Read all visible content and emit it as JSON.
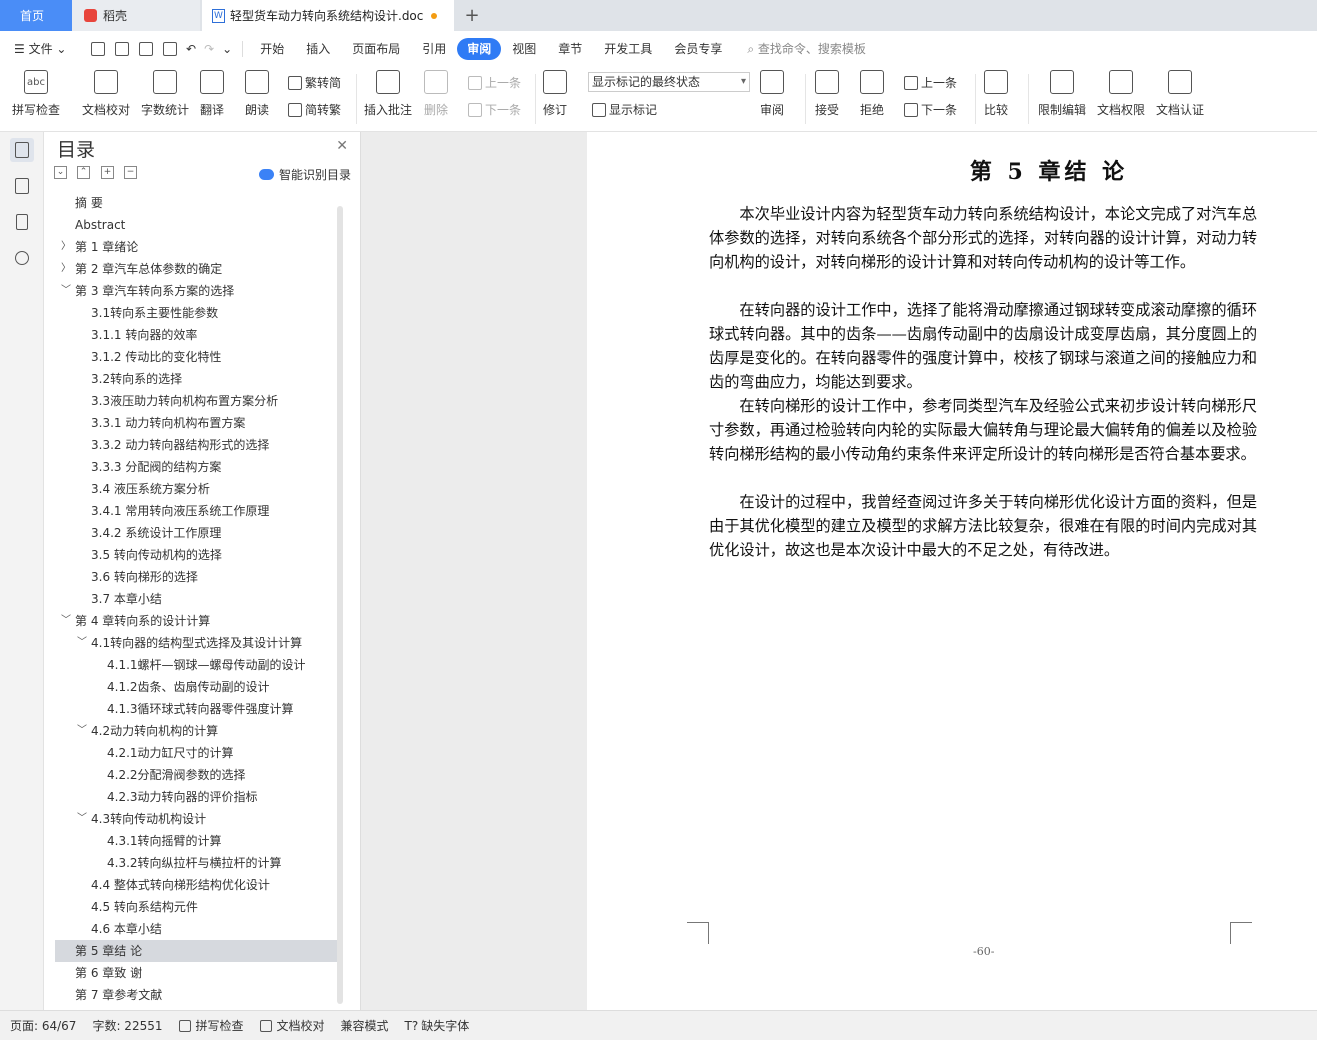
{
  "tabs": {
    "home": "首页",
    "daoke": "稻壳",
    "document": "轻型货车动力转向系统结构设计.doc"
  },
  "menu": {
    "file": "文件",
    "items": [
      "开始",
      "插入",
      "页面布局",
      "引用",
      "审阅",
      "视图",
      "章节",
      "开发工具",
      "会员专享"
    ],
    "active": "审阅",
    "search_placeholder": "查找命令、搜索模板"
  },
  "ribbon": {
    "spellcheck": "拼写检查",
    "proofread": "文档校对",
    "wordcount": "字数统计",
    "translate": "翻译",
    "read_aloud": "朗读",
    "trad_to_simp": "繁转简",
    "simp_to_trad": "简转繁",
    "insert_comment": "插入批注",
    "delete": "删除",
    "prev_comment": "上一条",
    "next_comment": "下一条",
    "track": "修订",
    "markup_state": "显示标记的最终状态",
    "show_markup": "显示标记",
    "review": "审阅",
    "accept": "接受",
    "reject": "拒绝",
    "prev_change": "上一条",
    "next_change": "下一条",
    "compare": "比较",
    "restrict": "限制编辑",
    "doc_rights": "文档权限",
    "doc_cert": "文档认证"
  },
  "toc": {
    "title": "目录",
    "smart": "智能识别目录",
    "items": [
      {
        "label": "摘 要",
        "level": 0,
        "arrow": ""
      },
      {
        "label": "Abstract",
        "level": 0,
        "arrow": ""
      },
      {
        "label": "第 1 章绪论",
        "level": 0,
        "arrow": "right"
      },
      {
        "label": "第 2 章汽车总体参数的确定",
        "level": 0,
        "arrow": "right"
      },
      {
        "label": "第 3 章汽车转向系方案的选择",
        "level": 0,
        "arrow": "down"
      },
      {
        "label": "3.1转向系主要性能参数",
        "level": 1,
        "arrow": ""
      },
      {
        "label": "3.1.1 转向器的效率",
        "level": 1,
        "arrow": ""
      },
      {
        "label": "3.1.2 传动比的变化特性",
        "level": 1,
        "arrow": ""
      },
      {
        "label": "3.2转向系的选择",
        "level": 1,
        "arrow": ""
      },
      {
        "label": "3.3液压助力转向机构布置方案分析",
        "level": 1,
        "arrow": ""
      },
      {
        "label": "3.3.1 动力转向机构布置方案",
        "level": 1,
        "arrow": ""
      },
      {
        "label": "3.3.2 动力转向器结构形式的选择",
        "level": 1,
        "arrow": ""
      },
      {
        "label": "3.3.3 分配阀的结构方案",
        "level": 1,
        "arrow": ""
      },
      {
        "label": "3.4 液压系统方案分析",
        "level": 1,
        "arrow": ""
      },
      {
        "label": "3.4.1 常用转向液压系统工作原理",
        "level": 1,
        "arrow": ""
      },
      {
        "label": "3.4.2 系统设计工作原理",
        "level": 1,
        "arrow": ""
      },
      {
        "label": "3.5 转向传动机构的选择",
        "level": 1,
        "arrow": ""
      },
      {
        "label": "3.6 转向梯形的选择",
        "level": 1,
        "arrow": ""
      },
      {
        "label": "3.7 本章小结",
        "level": 1,
        "arrow": ""
      },
      {
        "label": "第 4 章转向系的设计计算",
        "level": 0,
        "arrow": "down"
      },
      {
        "label": "4.1转向器的结构型式选择及其设计计算",
        "level": 1,
        "arrow": "down"
      },
      {
        "label": "4.1.1螺杆—钢球—螺母传动副的设计",
        "level": 2,
        "arrow": ""
      },
      {
        "label": "4.1.2齿条、齿扇传动副的设计",
        "level": 2,
        "arrow": ""
      },
      {
        "label": "4.1.3循环球式转向器零件强度计算",
        "level": 2,
        "arrow": ""
      },
      {
        "label": "4.2动力转向机构的计算",
        "level": 1,
        "arrow": "down"
      },
      {
        "label": "4.2.1动力缸尺寸的计算",
        "level": 2,
        "arrow": ""
      },
      {
        "label": "4.2.2分配滑阀参数的选择",
        "level": 2,
        "arrow": ""
      },
      {
        "label": "4.2.3动力转向器的评价指标",
        "level": 2,
        "arrow": ""
      },
      {
        "label": "4.3转向传动机构设计",
        "level": 1,
        "arrow": "down"
      },
      {
        "label": "4.3.1转向摇臂的计算",
        "level": 2,
        "arrow": ""
      },
      {
        "label": "4.3.2转向纵拉杆与横拉杆的计算",
        "level": 2,
        "arrow": ""
      },
      {
        "label": "4.4 整体式转向梯形结构优化设计",
        "level": 1,
        "arrow": ""
      },
      {
        "label": "4.5 转向系结构元件",
        "level": 1,
        "arrow": ""
      },
      {
        "label": "4.6 本章小结",
        "level": 1,
        "arrow": ""
      },
      {
        "label": "第 5 章结 论",
        "level": 0,
        "arrow": "",
        "selected": true
      },
      {
        "label": "第 6 章致 谢",
        "level": 0,
        "arrow": ""
      },
      {
        "label": "第 7 章参考文献",
        "level": 0,
        "arrow": ""
      }
    ]
  },
  "document": {
    "chapter_title": "第 5 章结 论",
    "paragraphs": [
      "本次毕业设计内容为轻型货车动力转向系统结构设计，本论文完成了对汽车总体参数的选择，对转向系统各个部分形式的选择，对转向器的设计计算，对动力转向机构的设计，对转向梯形的设计计算和对转向传动机构的设计等工作。",
      "在转向器的设计工作中，选择了能将滑动摩擦通过钢球转变成滚动摩擦的循环球式转向器。其中的齿条——齿扇传动副中的齿扇设计成变厚齿扇，其分度圆上的齿厚是变化的。在转向器零件的强度计算中，校核了钢球与滚道之间的接触应力和齿的弯曲应力，均能达到要求。",
      "在转向梯形的设计工作中，参考同类型汽车及经验公式来初步设计转向梯形尺寸参数，再通过检验转向内轮的实际最大偏转角与理论最大偏转角的偏差以及检验转向梯形结构的最小传动角约束条件来评定所设计的转向梯形是否符合基本要求。",
      "在设计的过程中，我曾经查阅过许多关于转向梯形优化设计方面的资料，但是由于其优化模型的建立及模型的求解方法比较复杂，很难在有限的时间内完成对其优化设计，故这也是本次设计中最大的不足之处，有待改进。"
    ],
    "page_number": "-60-"
  },
  "status": {
    "page": "页面: 64/67",
    "words": "字数: 22551",
    "spell": "拼写检查",
    "proof": "文档校对",
    "compat": "兼容模式",
    "missing_font": "缺失字体"
  }
}
